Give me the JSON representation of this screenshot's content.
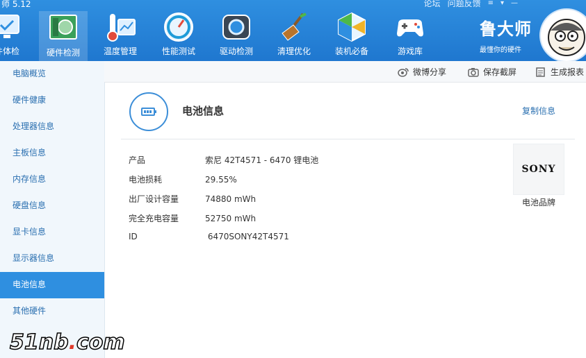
{
  "app": {
    "title_fragment": "师 5.12"
  },
  "titlebar": {
    "links": [
      "论坛",
      "问题反馈"
    ]
  },
  "nav": {
    "tools": [
      {
        "label": "件体检",
        "icon": "monitor-check-icon"
      },
      {
        "label": "硬件检测",
        "icon": "motherboard-icon"
      },
      {
        "label": "温度管理",
        "icon": "thermometer-icon"
      },
      {
        "label": "性能测试",
        "icon": "speedometer-icon"
      },
      {
        "label": "驱动检测",
        "icon": "driver-gear-icon"
      },
      {
        "label": "清理优化",
        "icon": "broom-icon"
      },
      {
        "label": "装机必备",
        "icon": "install-cube-icon"
      },
      {
        "label": "游戏库",
        "icon": "gamepad-icon"
      }
    ],
    "active_index": 1
  },
  "brand": {
    "name": "鲁大师",
    "slogan": "最懂你的硬件"
  },
  "sidebar": {
    "items": [
      "电脑概览",
      "硬件健康",
      "处理器信息",
      "主板信息",
      "内存信息",
      "硬盘信息",
      "显卡信息",
      "显示器信息",
      "电池信息",
      "其他硬件"
    ],
    "active_index": 8
  },
  "subtoolbar": {
    "weibo": "微博分享",
    "screenshot": "保存截屏",
    "report": "生成报表"
  },
  "section": {
    "title": "电池信息",
    "copy": "复制信息"
  },
  "battery": {
    "rows": [
      {
        "label": "产品",
        "value": "索尼 42T4571 -  6470 锂电池"
      },
      {
        "label": "电池损耗",
        "value": "29.55%"
      },
      {
        "label": "出厂设计容量",
        "value": "74880 mWh"
      },
      {
        "label": "完全充电容量",
        "value": "52750 mWh"
      },
      {
        "label": "ID",
        "value": " 6470SONY42T4571"
      }
    ],
    "brand_logo": "SONY",
    "brand_caption": "电池品牌"
  },
  "watermark": {
    "text": "51nb",
    "dot": ".",
    "suffix": "com"
  },
  "colors": {
    "accent": "#2f8fe0",
    "link": "#2a6fb0"
  }
}
